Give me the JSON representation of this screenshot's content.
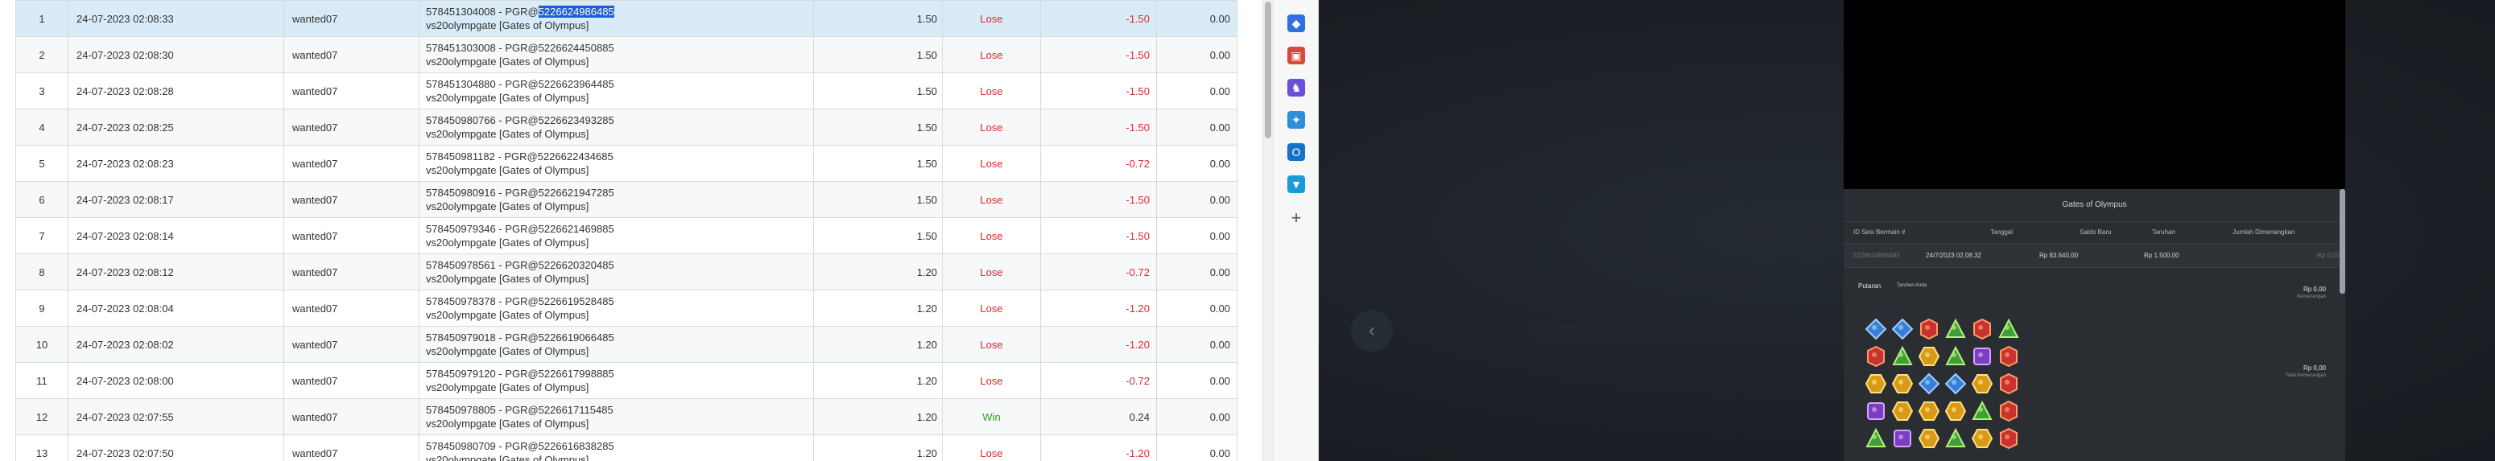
{
  "table": {
    "rows": [
      {
        "idx": "1",
        "date": "24-07-2023 02:08:33",
        "user": "wanted07",
        "desc1_pre": "578451304008 - PGR@",
        "desc1_hl": "5226624986485",
        "desc2": "vs20olympgate [Gates of Olympus]",
        "bet": "1.50",
        "result": "Lose",
        "amount": "-1.50",
        "balance": "0.00"
      },
      {
        "idx": "2",
        "date": "24-07-2023 02:08:30",
        "user": "wanted07",
        "desc1_pre": "578451303008 - PGR@5226624450885",
        "desc1_hl": "",
        "desc2": "vs20olympgate [Gates of Olympus]",
        "bet": "1.50",
        "result": "Lose",
        "amount": "-1.50",
        "balance": "0.00"
      },
      {
        "idx": "3",
        "date": "24-07-2023 02:08:28",
        "user": "wanted07",
        "desc1_pre": "578451304880 - PGR@5226623964485",
        "desc1_hl": "",
        "desc2": "vs20olympgate [Gates of Olympus]",
        "bet": "1.50",
        "result": "Lose",
        "amount": "-1.50",
        "balance": "0.00"
      },
      {
        "idx": "4",
        "date": "24-07-2023 02:08:25",
        "user": "wanted07",
        "desc1_pre": "578450980766 - PGR@5226623493285",
        "desc1_hl": "",
        "desc2": "vs20olympgate [Gates of Olympus]",
        "bet": "1.50",
        "result": "Lose",
        "amount": "-1.50",
        "balance": "0.00"
      },
      {
        "idx": "5",
        "date": "24-07-2023 02:08:23",
        "user": "wanted07",
        "desc1_pre": "578450981182 - PGR@5226622434685",
        "desc1_hl": "",
        "desc2": "vs20olympgate [Gates of Olympus]",
        "bet": "1.50",
        "result": "Lose",
        "amount": "-0.72",
        "balance": "0.00"
      },
      {
        "idx": "6",
        "date": "24-07-2023 02:08:17",
        "user": "wanted07",
        "desc1_pre": "578450980916 - PGR@5226621947285",
        "desc1_hl": "",
        "desc2": "vs20olympgate [Gates of Olympus]",
        "bet": "1.50",
        "result": "Lose",
        "amount": "-1.50",
        "balance": "0.00"
      },
      {
        "idx": "7",
        "date": "24-07-2023 02:08:14",
        "user": "wanted07",
        "desc1_pre": "578450979346 - PGR@5226621469885",
        "desc1_hl": "",
        "desc2": "vs20olympgate [Gates of Olympus]",
        "bet": "1.50",
        "result": "Lose",
        "amount": "-1.50",
        "balance": "0.00"
      },
      {
        "idx": "8",
        "date": "24-07-2023 02:08:12",
        "user": "wanted07",
        "desc1_pre": "578450978561 - PGR@5226620320485",
        "desc1_hl": "",
        "desc2": "vs20olympgate [Gates of Olympus]",
        "bet": "1.20",
        "result": "Lose",
        "amount": "-0.72",
        "balance": "0.00"
      },
      {
        "idx": "9",
        "date": "24-07-2023 02:08:04",
        "user": "wanted07",
        "desc1_pre": "578450978378 - PGR@5226619528485",
        "desc1_hl": "",
        "desc2": "vs20olympgate [Gates of Olympus]",
        "bet": "1.20",
        "result": "Lose",
        "amount": "-1.20",
        "balance": "0.00"
      },
      {
        "idx": "10",
        "date": "24-07-2023 02:08:02",
        "user": "wanted07",
        "desc1_pre": "578450979018 - PGR@5226619066485",
        "desc1_hl": "",
        "desc2": "vs20olympgate [Gates of Olympus]",
        "bet": "1.20",
        "result": "Lose",
        "amount": "-1.20",
        "balance": "0.00"
      },
      {
        "idx": "11",
        "date": "24-07-2023 02:08:00",
        "user": "wanted07",
        "desc1_pre": "578450979120 - PGR@5226617998885",
        "desc1_hl": "",
        "desc2": "vs20olympgate [Gates of Olympus]",
        "bet": "1.20",
        "result": "Lose",
        "amount": "-0.72",
        "balance": "0.00"
      },
      {
        "idx": "12",
        "date": "24-07-2023 02:07:55",
        "user": "wanted07",
        "desc1_pre": "578450978805 - PGR@5226617115485",
        "desc1_hl": "",
        "desc2": "vs20olympgate [Gates of Olympus]",
        "bet": "1.20",
        "result": "Win",
        "amount": "0.24",
        "balance": "0.00"
      },
      {
        "idx": "13",
        "date": "24-07-2023 02:07:50",
        "user": "wanted07",
        "desc1_pre": "578450980709 - PGR@5226616838285",
        "desc1_hl": "",
        "desc2": "vs20olympgate [Gates of Olympus]",
        "bet": "1.20",
        "result": "Lose",
        "amount": "-1.20",
        "balance": "0.00"
      }
    ]
  },
  "dock": {
    "icons": [
      "tag-icon",
      "toolbox-icon",
      "chess-icon",
      "copilot-icon",
      "outlook-icon",
      "cart-icon"
    ],
    "colors": [
      "#2f6fe0",
      "#d9483b",
      "#6b4fd8",
      "#2b8fdc",
      "#1273c9",
      "#1a9bd8"
    ],
    "plus": "+"
  },
  "viewer": {
    "back": "‹",
    "panel_title": "Gates of Olympus",
    "headers": {
      "id": "ID Sesi Bermain #",
      "date": "Tanggal",
      "balance": "Saldo Baru",
      "bet": "Taruhan",
      "win": "Jumlah Dimenangkan"
    },
    "round": {
      "id": "5226624986485",
      "date": "24/7/2023 02.08.32",
      "balance": "Rp 83.640,00",
      "bet": "Rp 1.500,00",
      "win": "Rp 0,00"
    },
    "spin_tab": "Putaran",
    "spin_subtab": "Taruhan Anda",
    "win_value": "Rp 0,00",
    "win_label": "Kemenangan",
    "total_value": "Rp 0,00",
    "total_label": "Total Kemenangan",
    "grid": [
      [
        "blue",
        "blue",
        "red",
        "green",
        "red",
        "green"
      ],
      [
        "red",
        "green",
        "yellow",
        "green",
        "purple",
        "red"
      ],
      [
        "yellow",
        "yellow",
        "blue",
        "blue",
        "yellow",
        "red"
      ],
      [
        "purple",
        "yellow",
        "yellow",
        "yellow",
        "green",
        "red"
      ],
      [
        "green",
        "purple",
        "yellow",
        "green",
        "yellow",
        "red"
      ]
    ]
  }
}
